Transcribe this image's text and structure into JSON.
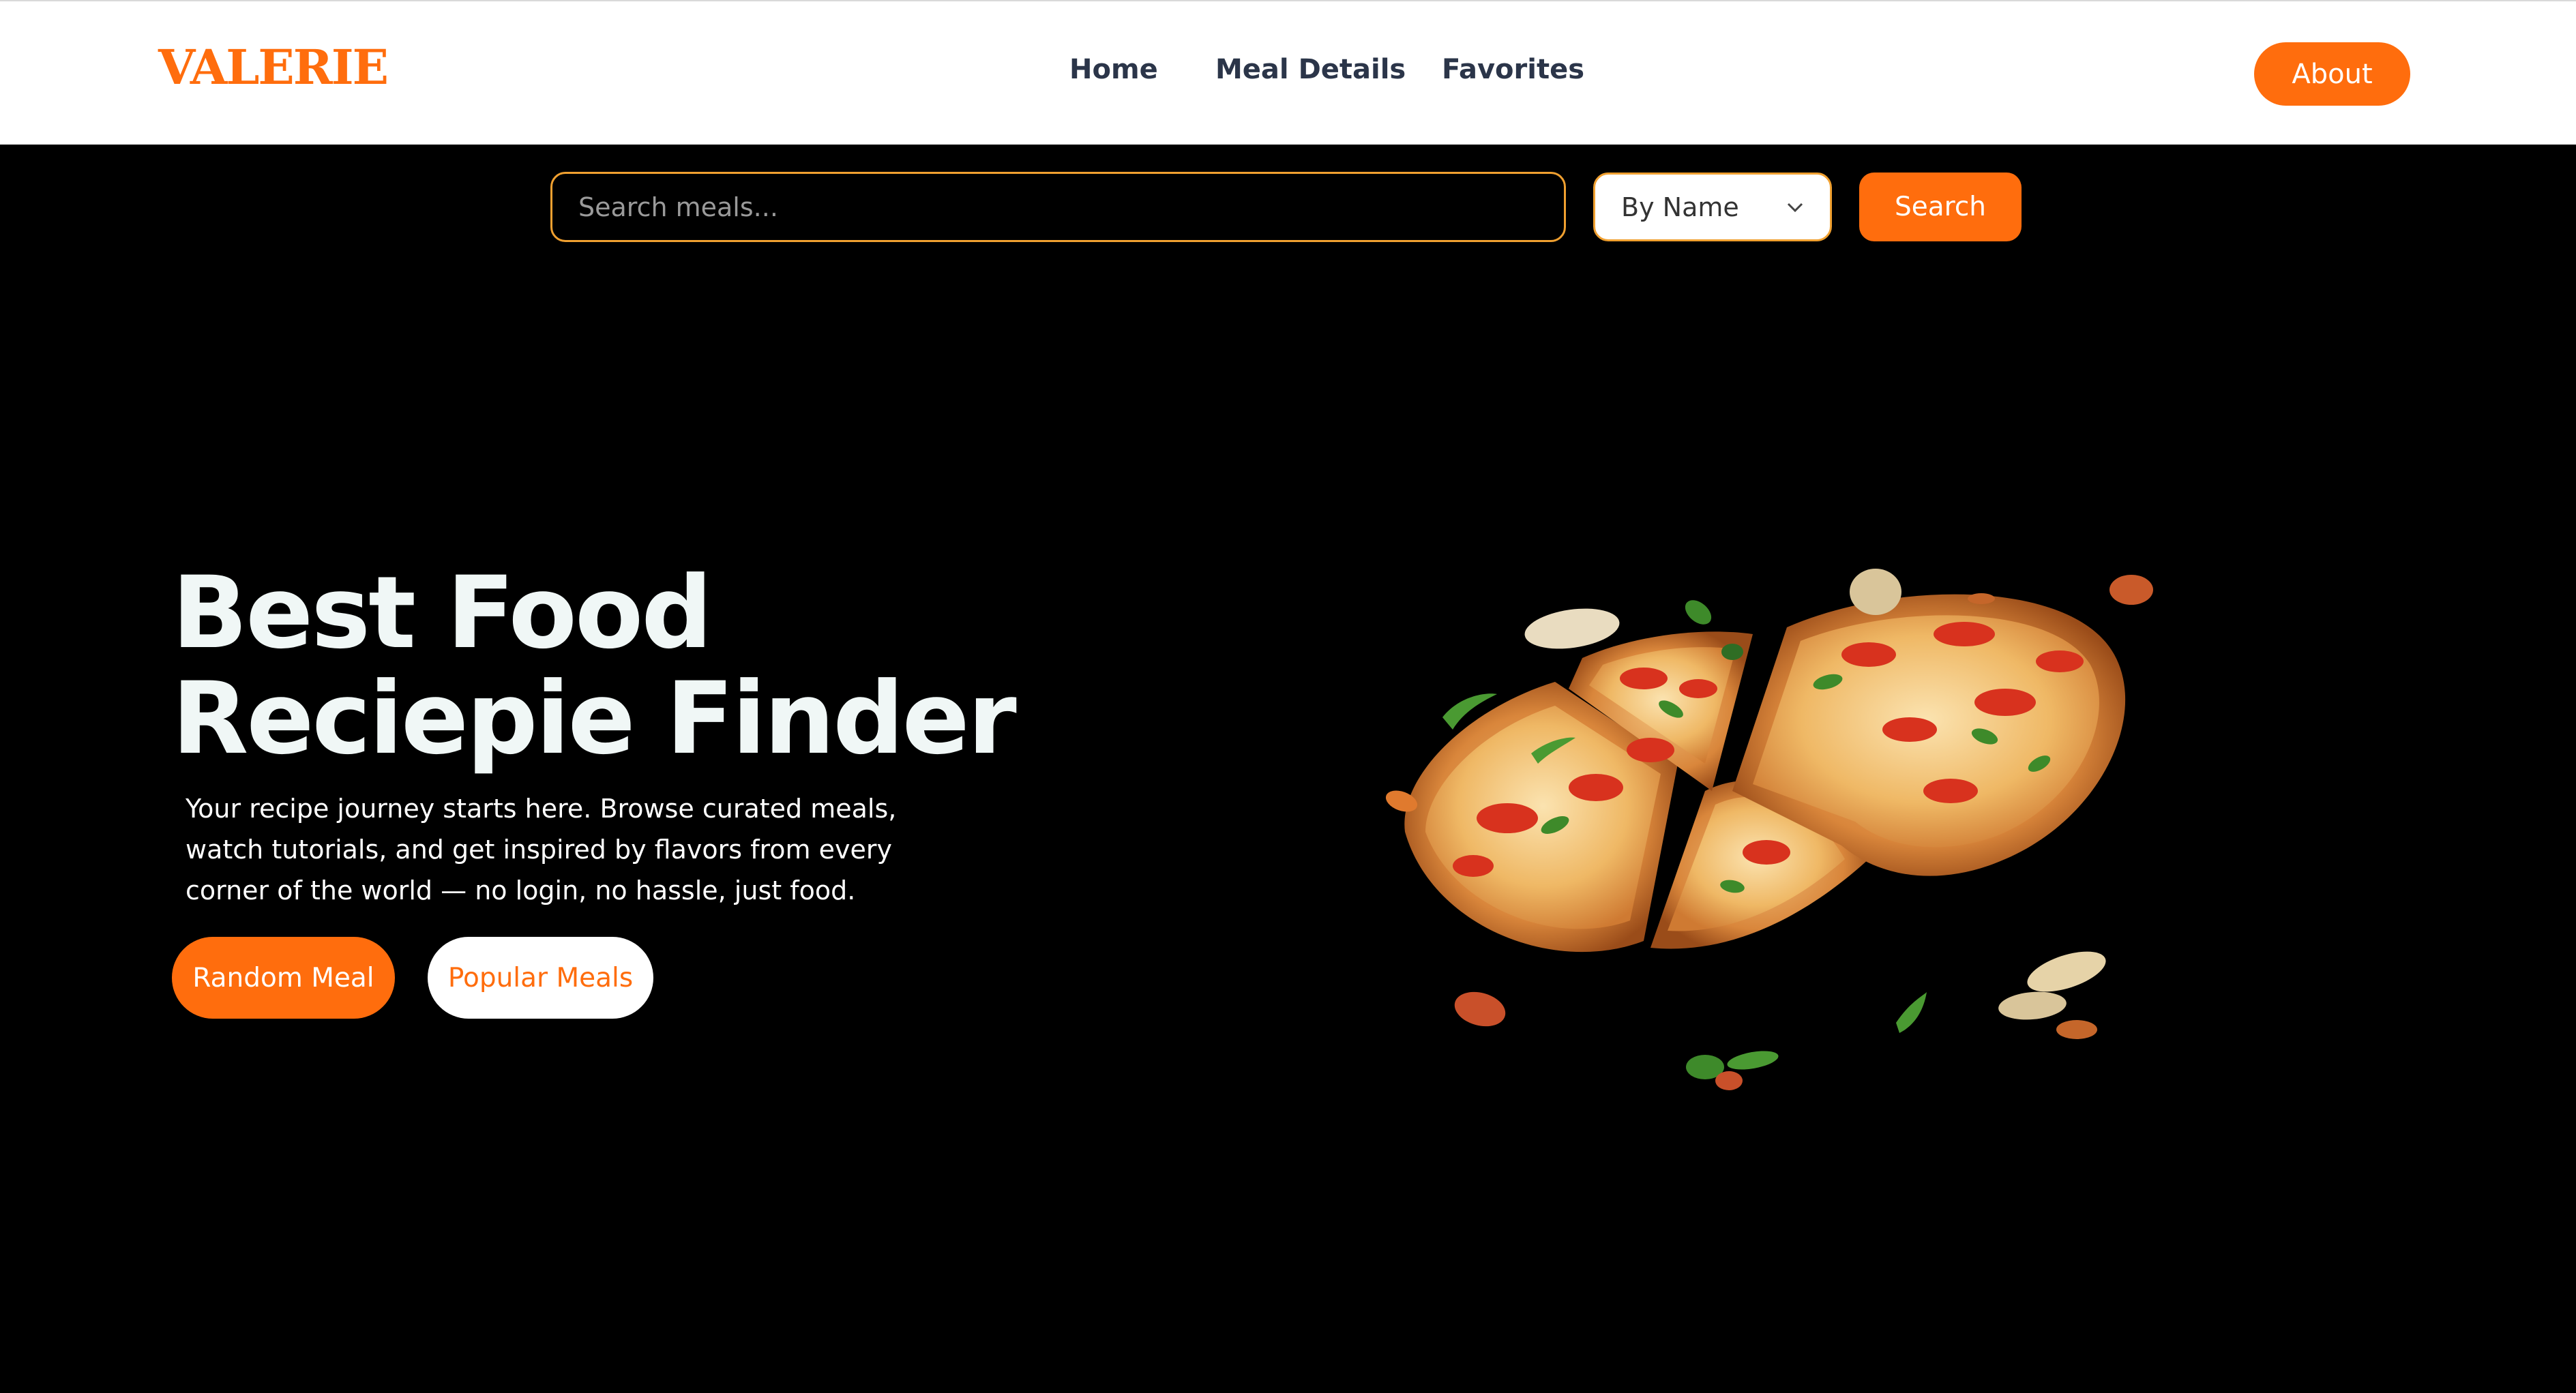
{
  "header": {
    "logo": "VALERIE",
    "nav": [
      {
        "label": "Home"
      },
      {
        "label": "Meal Details"
      },
      {
        "label": "Favorites"
      }
    ],
    "about_label": "About"
  },
  "search": {
    "placeholder": "Search meals...",
    "value": "",
    "filter_selected": "By Name",
    "button_label": "Search"
  },
  "hero": {
    "title_line1": "Best Food",
    "title_line2": "Reciepie Finder",
    "description": "Your recipe journey starts here. Browse curated meals, watch tutorials, and get inspired by flavors from every corner of the world — no login, no hassle, just food.",
    "primary_button": "Random Meal",
    "secondary_button": "Popular Meals",
    "image_icon": "pizza-image"
  },
  "colors": {
    "accent": "#ff6d0d",
    "nav_text": "#2b3549",
    "background": "#000000",
    "input_border": "#f0a030"
  }
}
